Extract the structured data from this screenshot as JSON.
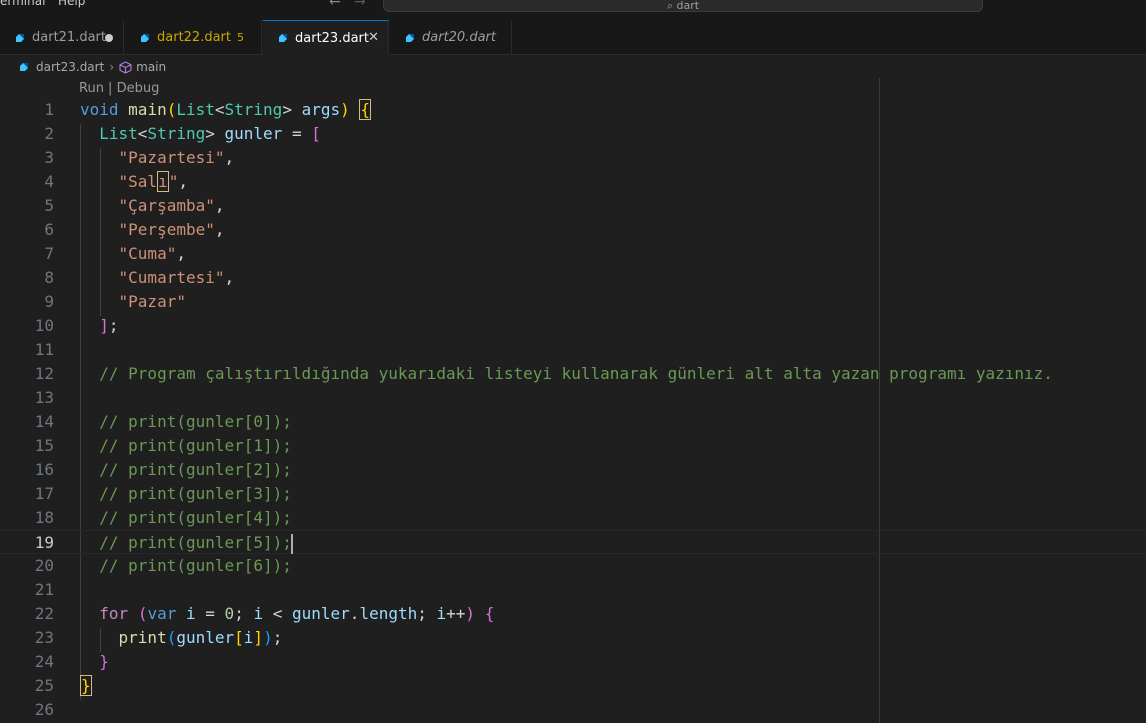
{
  "titlebar": {
    "menu": [
      "erminal",
      "Help"
    ],
    "search_text": "dart"
  },
  "tabs": [
    {
      "label": "dart21.dart",
      "state": "modified"
    },
    {
      "label": "dart22.dart",
      "badge": "5",
      "state": "warning"
    },
    {
      "label": "dart23.dart",
      "state": "active"
    },
    {
      "label": "dart20.dart",
      "state": "preview"
    }
  ],
  "breadcrumb": {
    "file": "dart23.dart",
    "symbol": "main"
  },
  "codelens": "Run | Debug",
  "line_numbers": [
    "1",
    "2",
    "3",
    "4",
    "5",
    "6",
    "7",
    "8",
    "9",
    "10",
    "11",
    "12",
    "13",
    "14",
    "15",
    "16",
    "17",
    "18",
    "19",
    "20",
    "21",
    "22",
    "23",
    "24",
    "25",
    "26"
  ],
  "current_line": 19,
  "code": {
    "l1": [
      "void",
      " ",
      "main",
      "(",
      "List",
      "<",
      "String",
      ">",
      " ",
      "args",
      ")",
      " ",
      "{"
    ],
    "l2": [
      "List",
      "<",
      "String",
      ">",
      " ",
      "gunler",
      " = ",
      "["
    ],
    "l3": "\"Pazartesi\"",
    "l4a": "\"Sal",
    "l4b": "ı",
    "l4c": "\"",
    "l5": "\"Çarşamba\"",
    "l6": "\"Perşembe\"",
    "l7": "\"Cuma\"",
    "l8": "\"Cumartesi\"",
    "l9": "\"Pazar\"",
    "l10": [
      "]",
      ";"
    ],
    "l12": "// Program çalıştırıldığında yukarıdaki listeyi kullanarak günleri alt alta yazan programı yazınız.",
    "l14": "// print(gunler[0]);",
    "l15": "// print(gunler[1]);",
    "l16": "// print(gunler[2]);",
    "l17": "// print(gunler[3]);",
    "l18": "// print(gunler[4]);",
    "l19": "// print(gunler[5]);",
    "l20": "// print(gunler[6]);",
    "l22": [
      "for",
      " ",
      "(",
      "var",
      " ",
      "i",
      " = ",
      "0",
      "; ",
      "i",
      " < ",
      "gunler",
      ".",
      "length",
      "; ",
      "i",
      "++",
      ")",
      " ",
      "{"
    ],
    "l23": [
      "print",
      "(",
      "gunler",
      "[",
      "i",
      "]",
      ")",
      ";"
    ],
    "l24": "}",
    "l25": "}",
    "comma": ","
  },
  "colors": {
    "accent": "#0078d4",
    "keyword": "#569cd6",
    "string": "#ce9178",
    "comment": "#6a9955"
  }
}
